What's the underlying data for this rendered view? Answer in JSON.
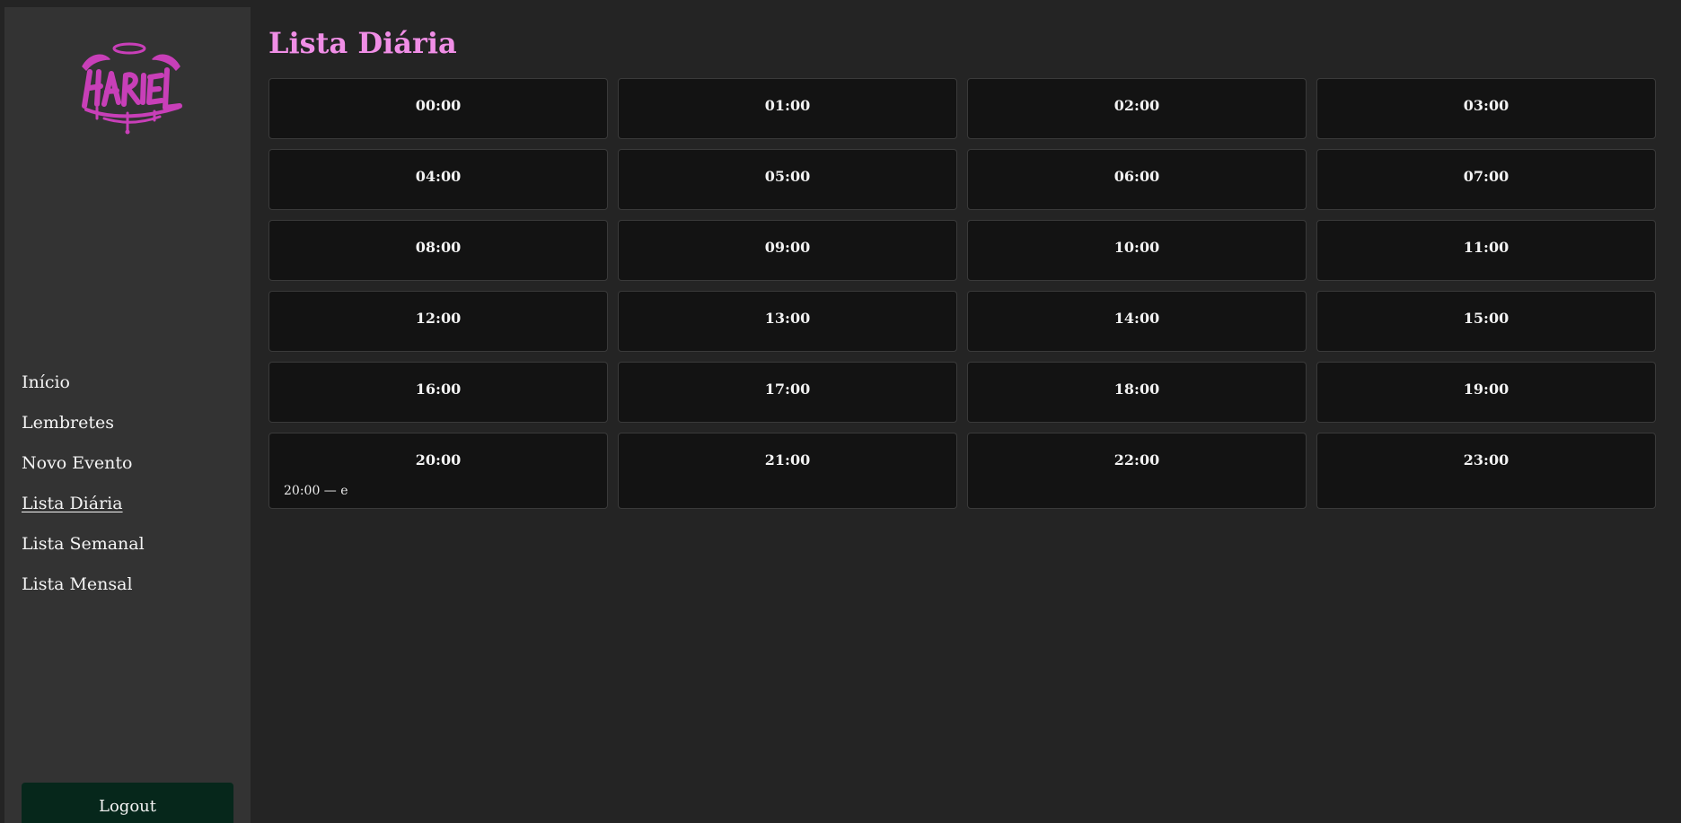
{
  "sidebar": {
    "logo_text": "HARIEL",
    "nav": [
      {
        "label": "Início",
        "active": false
      },
      {
        "label": "Lembretes",
        "active": false
      },
      {
        "label": "Novo Evento",
        "active": false
      },
      {
        "label": "Lista Diária",
        "active": true
      },
      {
        "label": "Lista Semanal",
        "active": false
      },
      {
        "label": "Lista Mensal",
        "active": false
      }
    ],
    "logout_label": "Logout"
  },
  "main": {
    "title": "Lista Diária",
    "hours": [
      {
        "label": "00:00",
        "events": []
      },
      {
        "label": "01:00",
        "events": []
      },
      {
        "label": "02:00",
        "events": []
      },
      {
        "label": "03:00",
        "events": []
      },
      {
        "label": "04:00",
        "events": []
      },
      {
        "label": "05:00",
        "events": []
      },
      {
        "label": "06:00",
        "events": []
      },
      {
        "label": "07:00",
        "events": []
      },
      {
        "label": "08:00",
        "events": []
      },
      {
        "label": "09:00",
        "events": []
      },
      {
        "label": "10:00",
        "events": []
      },
      {
        "label": "11:00",
        "events": []
      },
      {
        "label": "12:00",
        "events": []
      },
      {
        "label": "13:00",
        "events": []
      },
      {
        "label": "14:00",
        "events": []
      },
      {
        "label": "15:00",
        "events": []
      },
      {
        "label": "16:00",
        "events": []
      },
      {
        "label": "17:00",
        "events": []
      },
      {
        "label": "18:00",
        "events": []
      },
      {
        "label": "19:00",
        "events": []
      },
      {
        "label": "20:00",
        "events": [
          "20:00 — e"
        ]
      },
      {
        "label": "21:00",
        "events": []
      },
      {
        "label": "22:00",
        "events": []
      },
      {
        "label": "23:00",
        "events": []
      }
    ]
  },
  "colors": {
    "background": "#242424",
    "sidebar": "#333333",
    "card": "#131313",
    "card_border": "#3a3a3a",
    "title_accent": "#f08ee6",
    "logo": "#c83fb8",
    "logout_button": "#06271b"
  }
}
